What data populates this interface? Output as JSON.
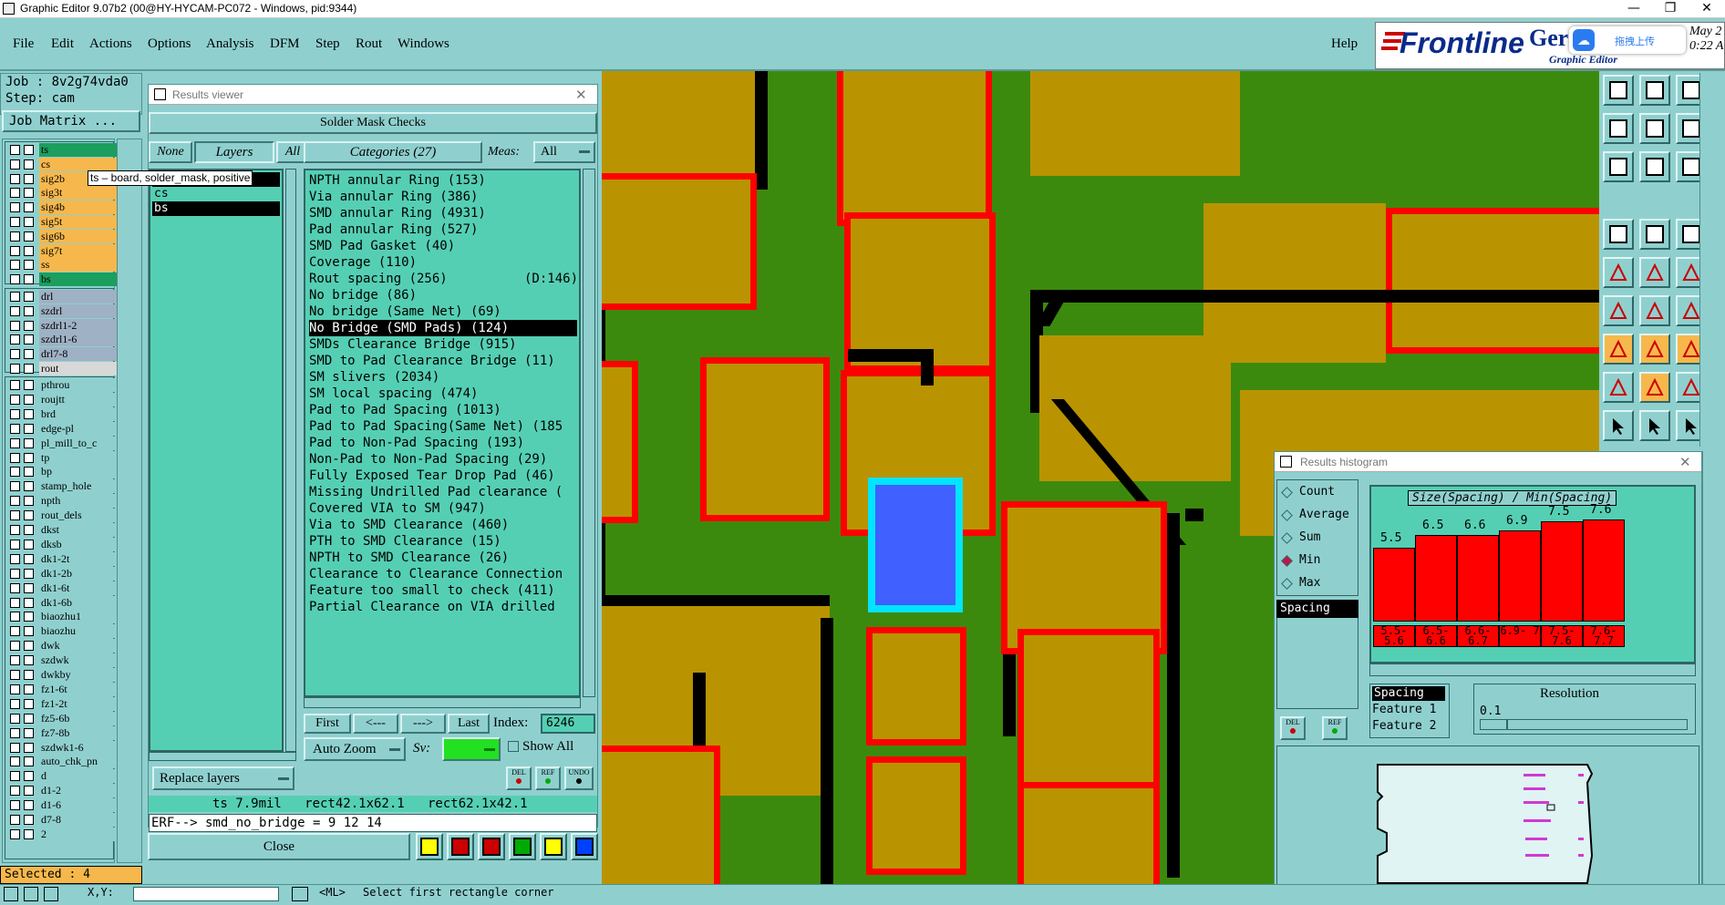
{
  "window": {
    "title": "Graphic Editor 9.07b2 (00@HY-HYCAM-PC072 - Windows, pid:9344)",
    "min": "—",
    "restore": "❐",
    "close": "✕"
  },
  "menu": [
    "File",
    "Edit",
    "Actions",
    "Options",
    "Analysis",
    "DFM",
    "Step",
    "Rout",
    "Windows"
  ],
  "help": "Help",
  "logo": {
    "brand": "Frontline",
    "product": "Ger",
    "subtitle": "Graphic Editor",
    "upload_btn": "拖拽上传",
    "date": "May 2",
    "time": "0:22 A"
  },
  "job": {
    "job": "Job : 8v2g74vda0",
    "step": "Step: cam",
    "matrix_btn": "Job Matrix ..."
  },
  "layers_a": [
    {
      "name": "ts",
      "color": "#1b9e5e"
    },
    {
      "name": "cs",
      "color": "#f6b84c"
    },
    {
      "name": "sig2b",
      "color": "#f6b84c"
    },
    {
      "name": "sig3t",
      "color": "#f6b84c"
    },
    {
      "name": "sig4b",
      "color": "#f6b84c"
    },
    {
      "name": "sig5t",
      "color": "#f6b84c"
    },
    {
      "name": "sig6b",
      "color": "#f6b84c"
    },
    {
      "name": "sig7t",
      "color": "#f6b84c"
    },
    {
      "name": "ss",
      "color": "#f6b84c"
    },
    {
      "name": "bs",
      "color": "#1b9e5e"
    }
  ],
  "layers_b": [
    {
      "name": "drl",
      "color": "#9fb1c5"
    },
    {
      "name": "szdrl",
      "color": "#9fb1c5"
    },
    {
      "name": "szdrl1-2",
      "color": "#9fb1c5"
    },
    {
      "name": "szdrl1-6",
      "color": "#9fb1c5"
    },
    {
      "name": "drl7-8",
      "color": "#9fb1c5"
    },
    {
      "name": "rout",
      "color": "#d8d8d8"
    }
  ],
  "layers_c": [
    "pthrou",
    "roujtt",
    "brd",
    "edge-pl",
    "pl_mill_to_c",
    "tp",
    "bp",
    "stamp_hole",
    "npth",
    "rout_dels",
    "dkst",
    "dksb",
    "dk1-2t",
    "dk1-2b",
    "dk1-6t",
    "dk1-6b",
    "biaozhu1",
    "biaozhu",
    "dwk",
    "szdwk",
    "dwkby",
    "fz1-6t",
    "fz1-2t",
    "fz5-6b",
    "fz7-8b",
    "szdwk1-6",
    "auto_chk_pn",
    "d",
    "d1-2",
    "d1-6",
    "d7-8",
    "2"
  ],
  "selected": "Selected : 4",
  "tooltip": "ts – board, solder_mask, positive",
  "results_viewer": {
    "title": "Results viewer",
    "header": "Solder Mask Checks",
    "btn_none": "None",
    "btn_layers": "Layers",
    "btn_all": "All",
    "layers": [
      "ts",
      "cs",
      "bs"
    ],
    "categories_btn": "Categories (27)",
    "meas_label": "Meas:",
    "meas_value": "All",
    "categories": [
      "NPTH annular Ring (153)",
      "Via annular Ring (386)",
      "SMD annular Ring (4931)",
      "Pad annular Ring (527)",
      "SMD Pad Gasket (40)",
      "Coverage (110)",
      "Rout spacing (256)          (D:146)",
      "No bridge (86)",
      "No bridge (Same Net) (69)",
      "No Bridge (SMD Pads) (124)",
      "SMDs Clearance Bridge (915)",
      "SMD to Pad Clearance Bridge (11)",
      "SM slivers (2034)",
      "SM local spacing (474)",
      "Pad to Pad Spacing (1013)",
      "Pad to Pad Spacing(Same Net) (185",
      "Pad to Non-Pad Spacing (193)",
      "Non-Pad to Non-Pad Spacing (29)",
      "Fully Exposed Tear Drop Pad (46)",
      "Missing Undrilled Pad clearance (",
      "Covered VIA to SM (947)",
      "Via to SMD Clearance (460)",
      "PTH to SMD Clearance (15)",
      "NPTH to SMD Clearance (26)",
      "Clearance to Clearance Connection",
      "Feature too small to check (411)",
      "Partial Clearance on VIA drilled"
    ],
    "selected_index": 9,
    "nav": {
      "first": "First",
      "prev": "<---",
      "next": "--->",
      "last": "Last",
      "index_label": "Index:",
      "index_value": "6246"
    },
    "auto_zoom": "Auto Zoom",
    "sv_label": "Sv:",
    "show_all": "Show All",
    "replace_layers": "Replace layers",
    "del": "DEL",
    "ref": "REF",
    "undo": "UNDO",
    "info": "ts 7.9mil   rect42.1x62.1   rect62.1x42.1",
    "erf": "ERF--> smd_no_bridge = 9 12 14",
    "close": "Close"
  },
  "histogram": {
    "title": "Results histogram",
    "options": [
      "Count",
      "Average",
      "Sum",
      "Min",
      "Max"
    ],
    "selected_option": "Min",
    "measure_list": [
      "Spacing"
    ],
    "chart_title": "Size(Spacing) / Min(Spacing)",
    "bars": [
      {
        "value": "5.5",
        "range": "5.5- 5.6",
        "level": 0.62
      },
      {
        "value": "6.5",
        "range": "6.5- 6.6",
        "level": 0.73
      },
      {
        "value": "6.6",
        "range": "6.6- 6.7",
        "level": 0.73
      },
      {
        "value": "6.9",
        "range": "6.9- 7",
        "level": 0.77
      },
      {
        "value": "7.5",
        "range": "7.5- 7.6",
        "level": 0.85
      },
      {
        "value": "7.6",
        "range": "7.6- 7.7",
        "level": 0.86
      }
    ],
    "fields": [
      "Spacing",
      "Feature 1",
      "Feature 2"
    ],
    "resolution_label": "Resolution",
    "resolution_value": "0.1",
    "del": "DEL",
    "ref": "REF"
  },
  "status": {
    "prompt": "<ML>",
    "message": "Select first rectangle corner",
    "xy": "X,Y:"
  }
}
